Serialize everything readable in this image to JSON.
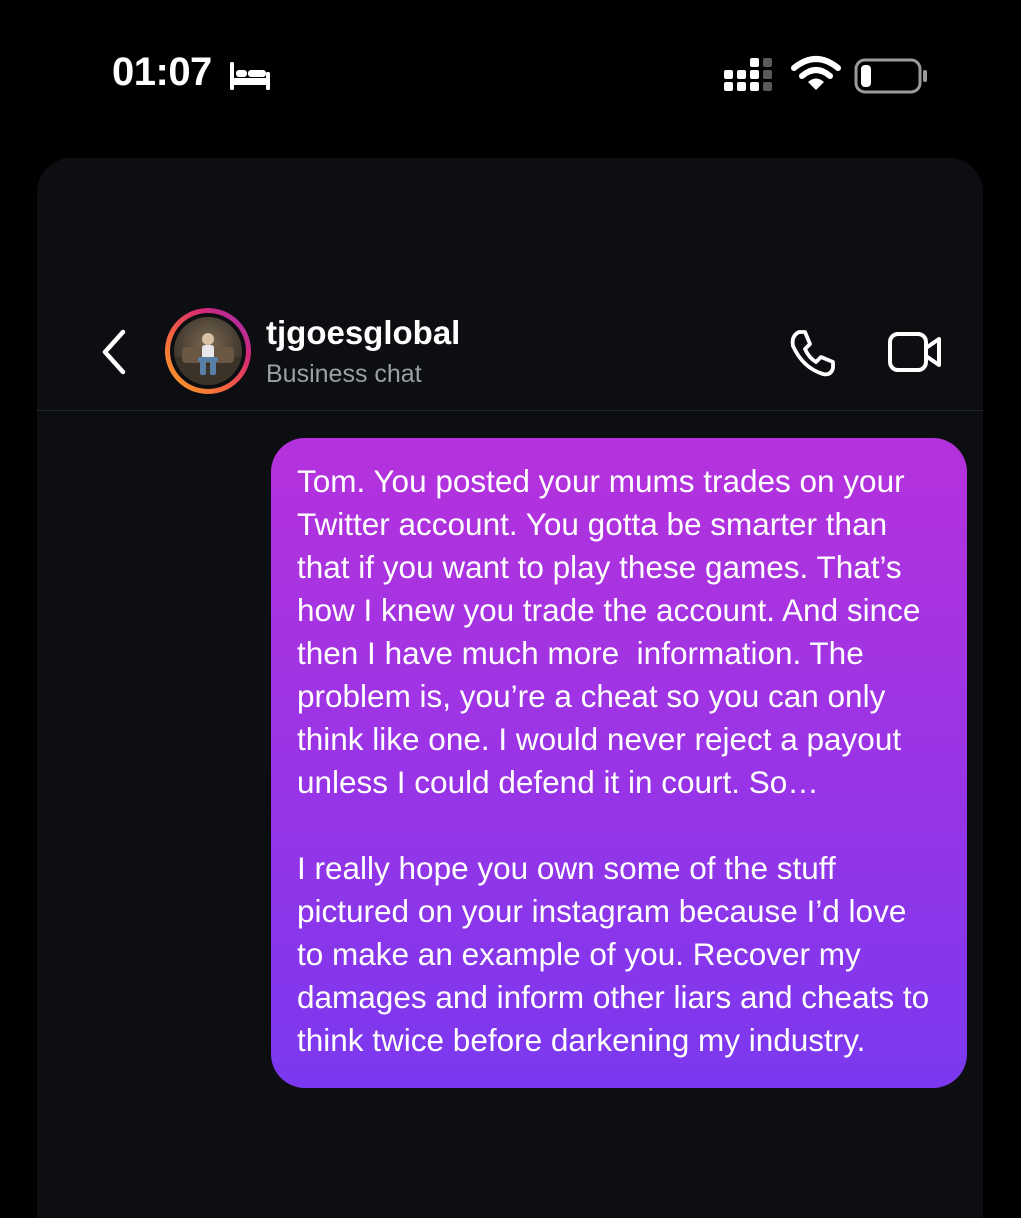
{
  "status_bar": {
    "time": "01:07",
    "icons": [
      "bed-icon",
      "signal-icon",
      "wifi-icon",
      "battery-icon"
    ]
  },
  "header": {
    "username": "tjgoesglobal",
    "subtitle": "Business chat",
    "icons": [
      "back-chevron-icon",
      "phone-icon",
      "video-camera-icon"
    ]
  },
  "messages": [
    {
      "direction": "outgoing",
      "paragraphs": [
        "Tom. You posted your mums trades on your Twitter account. You gotta be smarter than that if you want to play these games. That’s how I knew you trade the account. And since then I have much more  information. The problem is, you’re a cheat so you can only think like one. I would never reject a payout unless I could defend it in court. So…",
        "I really hope you own some of the stuff pictured on your instagram because I’d love to make an example of you. Recover my damages and inform other liars and cheats to think twice before darkening my industry."
      ]
    }
  ],
  "colors": {
    "background": "#000000",
    "panel": "#0c0e12",
    "bubble_top": "#b532dc",
    "bubble_bottom": "#7b38ee",
    "subtitle": "#9aa0a6"
  }
}
